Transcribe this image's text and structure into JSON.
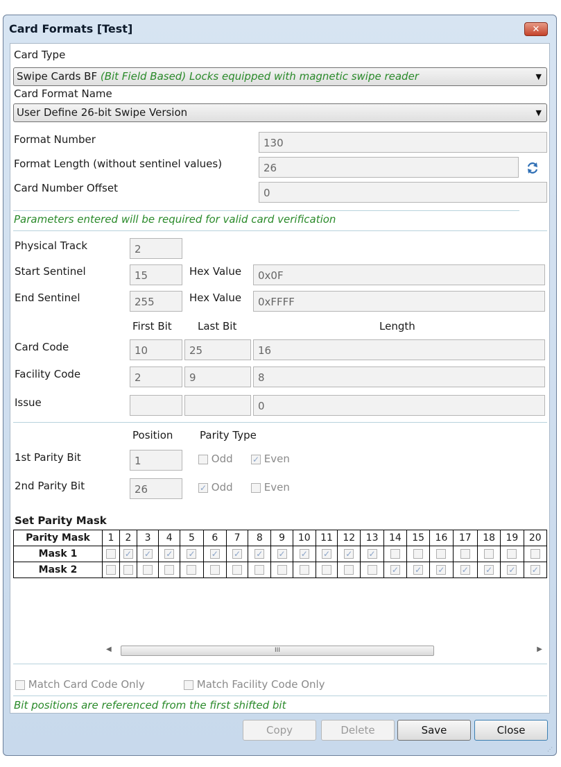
{
  "window": {
    "title": "Card Formats [Test]",
    "close_glyph": "✕"
  },
  "card_type": {
    "label": "Card Type",
    "value_plain": "Swipe Cards BF ",
    "value_italic": "(Bit Field Based) Locks equipped with magnetic swipe reader"
  },
  "card_format_name": {
    "label": "Card Format Name",
    "value": "User Define 26-bit Swipe Version"
  },
  "format_number": {
    "label": "Format Number",
    "value": "130"
  },
  "format_length": {
    "label": "Format Length (without sentinel values)",
    "value": "26"
  },
  "card_number_offset": {
    "label": "Card Number Offset",
    "value": "0"
  },
  "note_params": "Parameters entered will be required for valid card verification",
  "physical_track": {
    "label": "Physical Track",
    "value": "2"
  },
  "start_sentinel": {
    "label": "Start Sentinel",
    "value": "15",
    "hex_label": "Hex Value",
    "hex": "0x0F"
  },
  "end_sentinel": {
    "label": "End Sentinel",
    "value": "255",
    "hex_label": "Hex Value",
    "hex": "0xFFFF"
  },
  "bits_headers": {
    "first": "First Bit",
    "last": "Last Bit",
    "length": "Length"
  },
  "card_code": {
    "label": "Card Code",
    "first": "10",
    "last": "25",
    "length": "16"
  },
  "facility_code": {
    "label": "Facility Code",
    "first": "2",
    "last": "9",
    "length": "8"
  },
  "issue": {
    "label": "Issue",
    "first": "",
    "last": "",
    "length": "0"
  },
  "parity_headers": {
    "position": "Position",
    "type": "Parity Type"
  },
  "parity1": {
    "label": "1st Parity Bit",
    "position": "1",
    "odd_label": "Odd",
    "even_label": "Even",
    "odd": false,
    "even": true
  },
  "parity2": {
    "label": "2nd Parity Bit",
    "position": "26",
    "odd_label": "Odd",
    "even_label": "Even",
    "odd": true,
    "even": false
  },
  "parity_mask": {
    "title": "Set Parity Mask",
    "header": "Parity Mask",
    "columns": [
      "1",
      "2",
      "3",
      "4",
      "5",
      "6",
      "7",
      "8",
      "9",
      "10",
      "11",
      "12",
      "13",
      "14",
      "15",
      "16",
      "17",
      "18",
      "19",
      "20"
    ],
    "rows": [
      {
        "label": "Mask 1",
        "checked": [
          false,
          true,
          true,
          true,
          true,
          true,
          true,
          true,
          true,
          true,
          true,
          true,
          true,
          false,
          false,
          false,
          false,
          false,
          false,
          false
        ]
      },
      {
        "label": "Mask 2",
        "checked": [
          false,
          false,
          false,
          false,
          false,
          false,
          false,
          false,
          false,
          false,
          false,
          false,
          false,
          true,
          true,
          true,
          true,
          true,
          true,
          true
        ]
      }
    ],
    "scroll_grip": "III"
  },
  "match_card_code": {
    "label": "Match Card Code Only",
    "checked": false
  },
  "match_facility_code": {
    "label": "Match Facility Code Only",
    "checked": false
  },
  "note_bits": "Bit positions are referenced from the first shifted bit",
  "buttons": {
    "copy": "Copy",
    "delete": "Delete",
    "save": "Save",
    "close": "Close"
  },
  "icons": {
    "refresh": "refresh-icon",
    "dropdown": "chevron-down-icon",
    "check": "check-icon"
  }
}
